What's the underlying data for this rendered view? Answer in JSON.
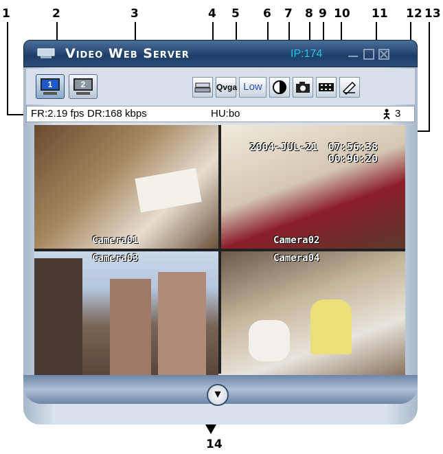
{
  "callouts": [
    "1",
    "2",
    "3",
    "4",
    "5",
    "6",
    "7",
    "8",
    "9",
    "10",
    "11",
    "12",
    "13",
    "14"
  ],
  "window": {
    "title": "Video Web Server",
    "ip": "IP:174"
  },
  "toolbar": {
    "channel_buttons": [
      "1",
      "2"
    ],
    "resolution_label": "Qvga",
    "quality_label": "Low"
  },
  "status": {
    "fr": "FR:2.19 fps",
    "dr": "DR:168 kbps",
    "hu": "HU:bo",
    "users": "3"
  },
  "video": {
    "date": "2004-JUL-21",
    "time": "07:56:38",
    "time2": "00:90:20",
    "cameras": [
      "Camera01",
      "Camera02",
      "Camera03",
      "Camera04"
    ]
  },
  "icons": [
    "app-icon",
    "hard-drive-icon",
    "contrast-icon",
    "camera-icon",
    "film-icon",
    "settings-icon",
    "user-icon",
    "chevron-down-icon"
  ]
}
